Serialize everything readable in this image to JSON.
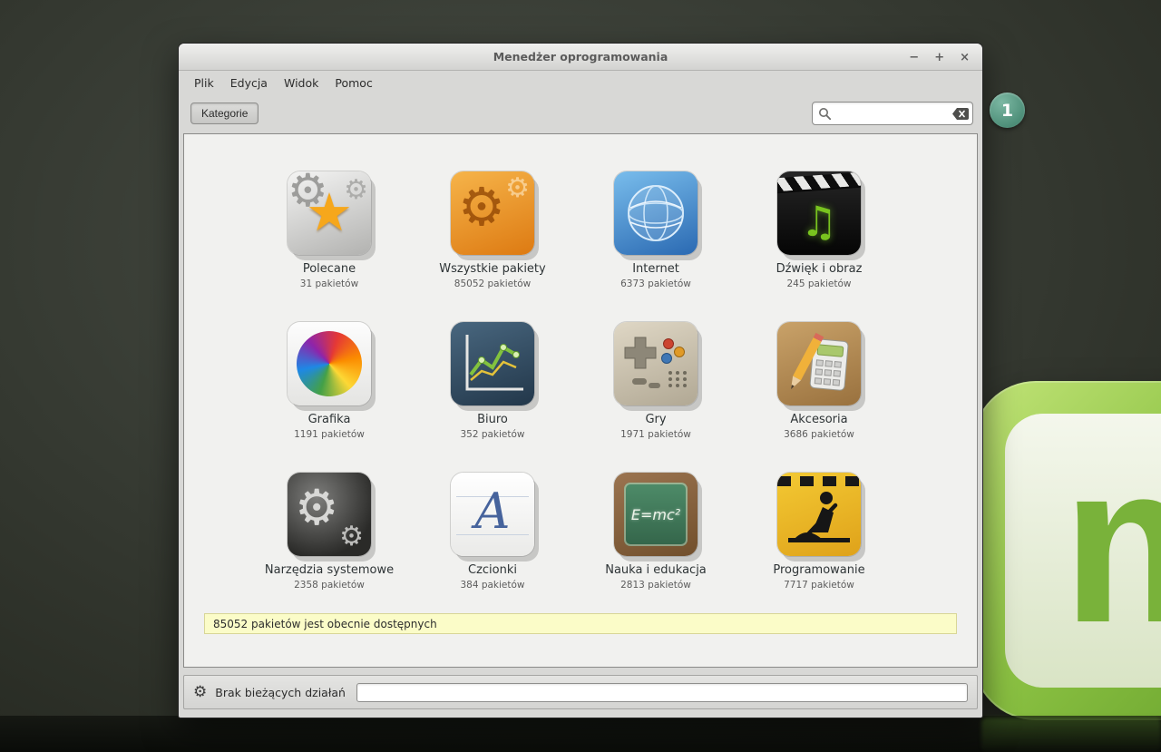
{
  "desktop": {
    "badge": "1",
    "logo_letter": "m"
  },
  "window": {
    "title": "Menedżer oprogramowania",
    "controls": {
      "minimize": "−",
      "maximize": "+",
      "close": "×"
    },
    "menu": {
      "items": [
        {
          "label": "Plik"
        },
        {
          "label": "Edycja"
        },
        {
          "label": "Widok"
        },
        {
          "label": "Pomoc"
        }
      ]
    },
    "toolbar": {
      "categories_label": "Kategorie",
      "search_placeholder": ""
    },
    "categories": [
      {
        "name": "Polecane",
        "count": "31 pakietów"
      },
      {
        "name": "Wszystkie pakiety",
        "count": "85052 pakietów"
      },
      {
        "name": "Internet",
        "count": "6373 pakietów"
      },
      {
        "name": "Dźwięk i obraz",
        "count": "245 pakietów"
      },
      {
        "name": "Grafika",
        "count": "1191 pakietów"
      },
      {
        "name": "Biuro",
        "count": "352 pakietów"
      },
      {
        "name": "Gry",
        "count": "1971 pakietów"
      },
      {
        "name": "Akcesoria",
        "count": "3686 pakietów"
      },
      {
        "name": "Narzędzia systemowe",
        "count": "2358 pakietów"
      },
      {
        "name": "Czcionki",
        "count": "384 pakietów"
      },
      {
        "name": "Nauka i edukacja",
        "count": "2813 pakietów"
      },
      {
        "name": "Programowanie",
        "count": "7717 pakietów"
      }
    ],
    "infobar_text": "85052 pakietów jest obecnie dostępnych",
    "statusbar": {
      "status_text": "Brak bieżących działań"
    }
  },
  "glyphs": {
    "gear": "⚙",
    "star": "★",
    "note": "♫",
    "letter_a": "A",
    "formula": "E=mc²"
  },
  "colors": {
    "accent_green": "#8cc243",
    "badge_green": "#4e8f79",
    "infobar_yellow": "#fbfcc8"
  }
}
